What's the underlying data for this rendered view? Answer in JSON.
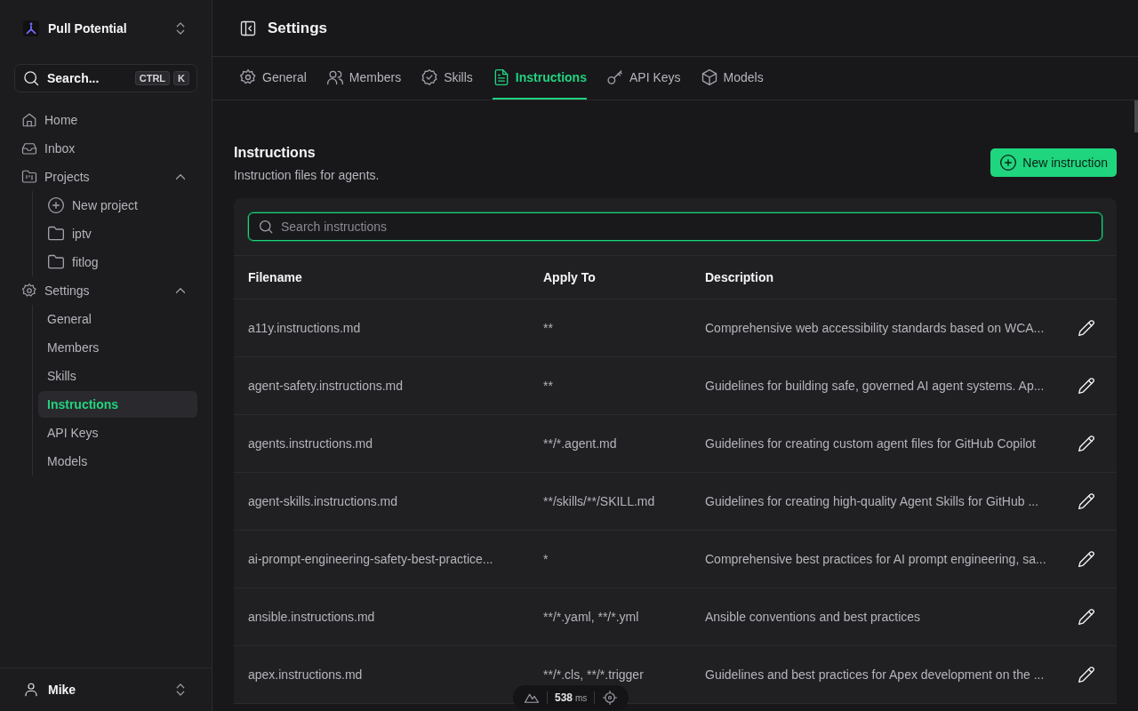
{
  "sidebar": {
    "workspace": "Pull Potential",
    "search": {
      "placeholder": "Search...",
      "keys": [
        "CTRL",
        "K"
      ]
    },
    "items": [
      {
        "label": "Home",
        "kind": "link"
      },
      {
        "label": "Inbox",
        "kind": "link"
      },
      {
        "label": "Projects",
        "kind": "group",
        "expanded": true,
        "children": [
          {
            "label": "New project",
            "kind": "action",
            "selected": false
          },
          {
            "label": "iptv",
            "kind": "folder",
            "selected": false
          },
          {
            "label": "fitlog",
            "kind": "folder",
            "selected": false
          }
        ]
      },
      {
        "label": "Settings",
        "kind": "group",
        "expanded": true,
        "children": [
          {
            "label": "General",
            "kind": "page",
            "selected": false
          },
          {
            "label": "Members",
            "kind": "page",
            "selected": false
          },
          {
            "label": "Skills",
            "kind": "page",
            "selected": false
          },
          {
            "label": "Instructions",
            "kind": "page",
            "selected": true
          },
          {
            "label": "API Keys",
            "kind": "page",
            "selected": false
          },
          {
            "label": "Models",
            "kind": "page",
            "selected": false
          }
        ]
      }
    ],
    "user": "Mike"
  },
  "header": {
    "title": "Settings"
  },
  "tabs": [
    {
      "label": "General",
      "selected": false
    },
    {
      "label": "Members",
      "selected": false
    },
    {
      "label": "Skills",
      "selected": false
    },
    {
      "label": "Instructions",
      "selected": true
    },
    {
      "label": "API Keys",
      "selected": false
    },
    {
      "label": "Models",
      "selected": false
    }
  ],
  "section": {
    "title": "Instructions",
    "subtitle": "Instruction files for agents.",
    "button": "New instruction"
  },
  "search": {
    "placeholder": "Search instructions"
  },
  "table": {
    "columns": [
      "Filename",
      "Apply To",
      "Description"
    ],
    "rows": [
      {
        "filename": "a11y.instructions.md",
        "apply_to": "**",
        "description": "Comprehensive web accessibility standards based on WCA..."
      },
      {
        "filename": "agent-safety.instructions.md",
        "apply_to": "**",
        "description": "Guidelines for building safe, governed AI agent systems. Ap..."
      },
      {
        "filename": "agents.instructions.md",
        "apply_to": "**/*.agent.md",
        "description": "Guidelines for creating custom agent files for GitHub Copilot"
      },
      {
        "filename": "agent-skills.instructions.md",
        "apply_to": "**/skills/**/SKILL.md",
        "description": "Guidelines for creating high-quality Agent Skills for GitHub ..."
      },
      {
        "filename": "ai-prompt-engineering-safety-best-practice...",
        "apply_to": "*",
        "description": "Comprehensive best practices for AI prompt engineering, sa..."
      },
      {
        "filename": "ansible.instructions.md",
        "apply_to": "**/*.yaml, **/*.yml",
        "description": "Ansible conventions and best practices"
      },
      {
        "filename": "apex.instructions.md",
        "apply_to": "**/*.cls, **/*.trigger",
        "description": "Guidelines and best practices for Apex development on the ..."
      }
    ]
  },
  "devtools": {
    "timing": "538",
    "unit": "ms"
  }
}
